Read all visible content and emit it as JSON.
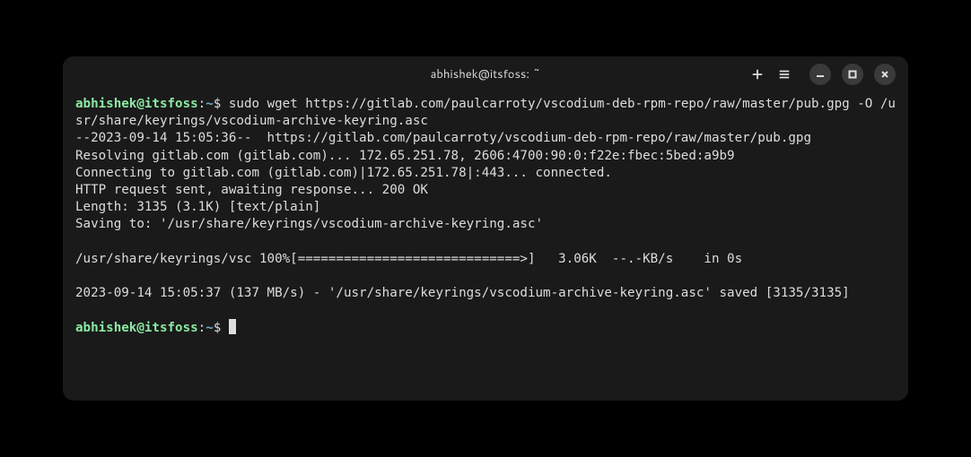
{
  "titlebar": {
    "title": "abhishek@itsfoss: ~"
  },
  "prompt1": {
    "userhost": "abhishek@itsfoss",
    "colon": ":",
    "path": "~",
    "dollar": "$ ",
    "command": "sudo wget https://gitlab.com/paulcarroty/vscodium-deb-rpm-repo/raw/master/pub.gpg -O /usr/share/keyrings/vscodium-archive-keyring.asc"
  },
  "output": {
    "l1": "--2023-09-14 15:05:36--  https://gitlab.com/paulcarroty/vscodium-deb-rpm-repo/raw/master/pub.gpg",
    "l2": "Resolving gitlab.com (gitlab.com)... 172.65.251.78, 2606:4700:90:0:f22e:fbec:5bed:a9b9",
    "l3": "Connecting to gitlab.com (gitlab.com)|172.65.251.78|:443... connected.",
    "l4": "HTTP request sent, awaiting response... 200 OK",
    "l5": "Length: 3135 (3.1K) [text/plain]",
    "l6": "Saving to: '/usr/share/keyrings/vscodium-archive-keyring.asc'",
    "blank1": "",
    "l7": "/usr/share/keyrings/vsc 100%[=============================>]   3.06K  --.-KB/s    in 0s",
    "blank2": "",
    "l8": "2023-09-14 15:05:37 (137 MB/s) - '/usr/share/keyrings/vscodium-archive-keyring.asc' saved [3135/3135]",
    "blank3": ""
  },
  "prompt2": {
    "userhost": "abhishek@itsfoss",
    "colon": ":",
    "path": "~",
    "dollar": "$ "
  }
}
